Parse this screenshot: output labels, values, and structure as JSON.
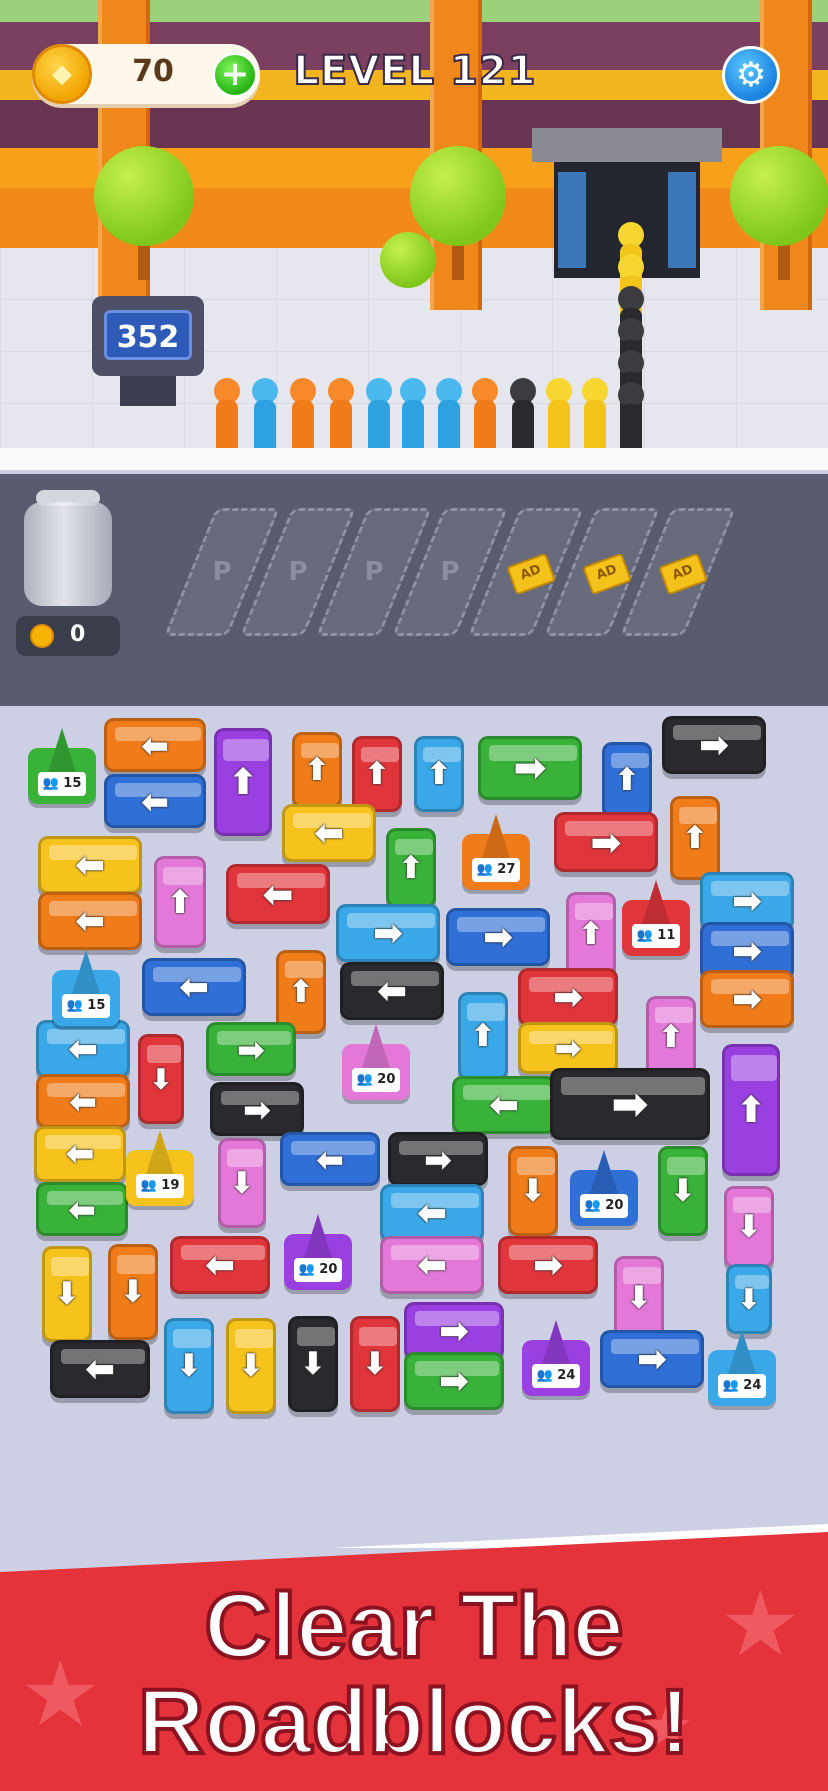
{
  "hud": {
    "coins": "70",
    "add_icon": "plus-icon",
    "level": "LEVEL 121",
    "settings_icon": "gear-icon"
  },
  "scene": {
    "queue_counter": "352"
  },
  "parking": {
    "jar_coins": "0",
    "slot_mark": "P",
    "ad_label": "AD"
  },
  "cones": [
    "15",
    "27",
    "11",
    "15",
    "20",
    "19",
    "20",
    "20",
    "24",
    "24"
  ],
  "banner": {
    "line1": "Clear The",
    "line2": "Roadblocks!"
  },
  "colors": {
    "orange": "#f07b19",
    "blue": "#2f6fd6",
    "purple": "#9a3fe0",
    "red": "#e0353a",
    "cyan": "#3aa8e8",
    "green": "#39b239",
    "black": "#2a2a2e",
    "yellow": "#f6c21c",
    "pink": "#e478d8"
  }
}
